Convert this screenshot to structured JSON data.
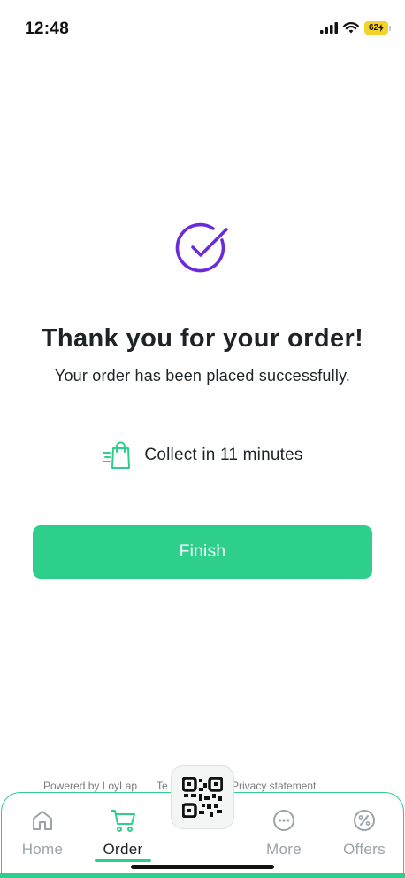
{
  "status_bar": {
    "time": "12:48",
    "battery": "62",
    "icons": [
      "signal-icon",
      "wifi-icon",
      "battery-charging-icon"
    ]
  },
  "confirmation": {
    "icon": "check-circle-icon",
    "title": "Thank you for your order!",
    "subtitle": "Your order has been placed successfully.",
    "collect_icon": "shopping-bag-icon",
    "collect_text": "Collect in 11 minutes",
    "finish_label": "Finish"
  },
  "footer": {
    "powered_by": "Powered by LoyLap",
    "terms": "Te",
    "privacy": "Privacy statement"
  },
  "bottom_nav": {
    "items": [
      {
        "label": "Home",
        "icon": "home-icon",
        "active": false
      },
      {
        "label": "Order",
        "icon": "cart-icon",
        "active": true
      },
      {
        "label": "More",
        "icon": "more-icon",
        "active": false
      },
      {
        "label": "Offers",
        "icon": "percent-icon",
        "active": false
      }
    ],
    "center_button_icon": "qr-code-icon"
  },
  "colors": {
    "accent": "#2ecf8a",
    "check": "#6c2bd9",
    "text": "#1d2327",
    "muted": "#9aa3a8"
  }
}
